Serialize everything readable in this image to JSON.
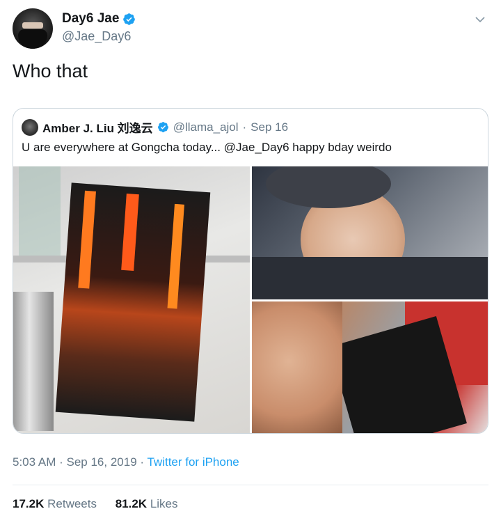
{
  "tweet": {
    "author": {
      "display_name": "Day6 Jae",
      "handle": "@Jae_Day6",
      "verified": true
    },
    "text": "Who that",
    "timestamp": "5:03 AM",
    "date": "Sep 16, 2019",
    "source": "Twitter for iPhone",
    "retweets": "17.2K",
    "retweets_label": "Retweets",
    "likes": "81.2K",
    "likes_label": "Likes"
  },
  "quoted": {
    "display_name": "Amber J. Liu 刘逸云",
    "handle": "@llama_ajol",
    "date": "Sep 16",
    "text": "U are everywhere at Gongcha today... @Jae_Day6 happy bday weirdo"
  },
  "colors": {
    "link": "#1da1f2",
    "muted": "#657786",
    "text": "#14171a",
    "verified": "#1da1f2"
  },
  "icons": [
    "verified-badge-icon",
    "chevron-down-icon"
  ]
}
